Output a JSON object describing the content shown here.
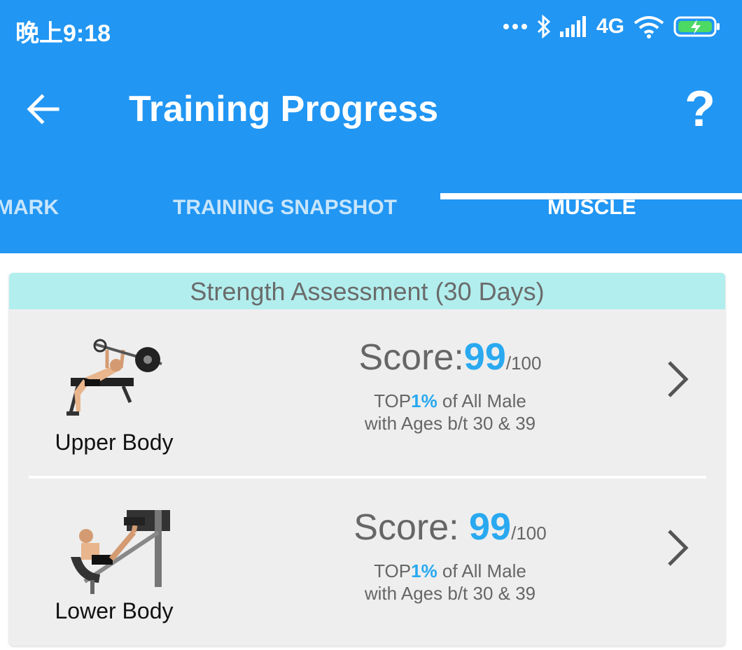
{
  "status_bar": {
    "time": "晚上9:18",
    "network": "4G",
    "icons": [
      "more-dots-icon",
      "bluetooth-icon",
      "signal-icon",
      "wifi-icon",
      "battery-charging-icon"
    ]
  },
  "app_bar": {
    "title": "Training Progress",
    "help_label": "?",
    "back_icon": "arrow-left-icon"
  },
  "tabs": [
    {
      "label": "MARK",
      "selected": false
    },
    {
      "label": "TRAINING SNAPSHOT",
      "selected": false
    },
    {
      "label": "MUSCLE",
      "selected": true
    }
  ],
  "card": {
    "header": "Strength Assessment (30 Days)",
    "rows": [
      {
        "label": "Upper Body",
        "score_prefix": "Score:",
        "score": "99",
        "score_max": "/100",
        "rank_prefix": "TOP",
        "rank_pct": "1%",
        "rank_suffix": " of All Male",
        "age_text": "with Ages b/t 30 & 39"
      },
      {
        "label": "Lower Body",
        "score_prefix": "Score: ",
        "score": "99",
        "score_max": "/100",
        "rank_prefix": "TOP",
        "rank_pct": "1%",
        "rank_suffix": " of All Male",
        "age_text": "with Ages b/t 30 & 39"
      }
    ]
  },
  "colors": {
    "primary": "#2196f3",
    "accent": "#29a9f0",
    "header_bg": "#b2eeee",
    "card_bg": "#eeeeee"
  }
}
